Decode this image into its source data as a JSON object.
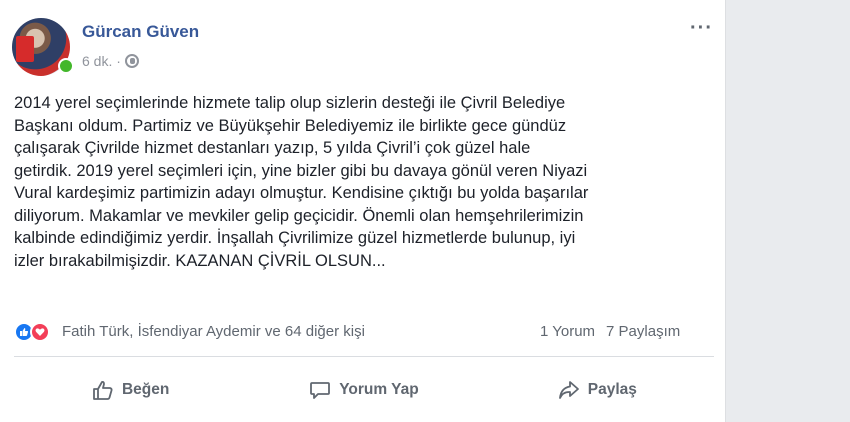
{
  "post": {
    "author": "Gürcan Güven",
    "time": "6 dk. ·",
    "text_lines": [
      "2014 yerel seçimlerinde hizmete talip olup sizlerin desteği ile Çivril Belediye",
      "Başkanı oldum. Partimiz ve Büyükşehir Belediyemiz ile birlikte gece gündüz",
      "çalışarak Çivrilde hizmet destanları yazıp, 5 yılda Çivril’i çok güzel hale",
      "getirdik. 2019 yerel seçimleri için, yine bizler gibi bu davaya gönül veren Niyazi",
      "Vural kardeşimiz partimizin adayı olmuştur. Kendisine çıktığı bu yolda başarılar",
      "diliyorum. Makamlar ve mevkiler gelip geçicidir. Önemli olan hemşehrilerimizin",
      "kalbinde edindiğimiz yerdir. İnşallah Çivrilimize güzel hizmetlerde bulunup, iyi",
      "izler bırakabilmişizdir. KAZANAN ÇİVRİL OLSUN..."
    ]
  },
  "reactions": {
    "likers": "Fatih Türk, İsfendiyar Aydemir ve 64 diğer kişi",
    "comments": "1 Yorum",
    "shares": "7 Paylaşım",
    "icons": [
      "like-reaction-icon",
      "love-reaction-icon"
    ]
  },
  "actions": {
    "like": "Beğen",
    "comment": "Yorum Yap",
    "share": "Paylaş"
  },
  "colors": {
    "author": "#385898",
    "text": "#1d2129",
    "secondary": "#606770",
    "online": "#42b72a",
    "like": "#1877f2",
    "love": "#f33e58"
  }
}
